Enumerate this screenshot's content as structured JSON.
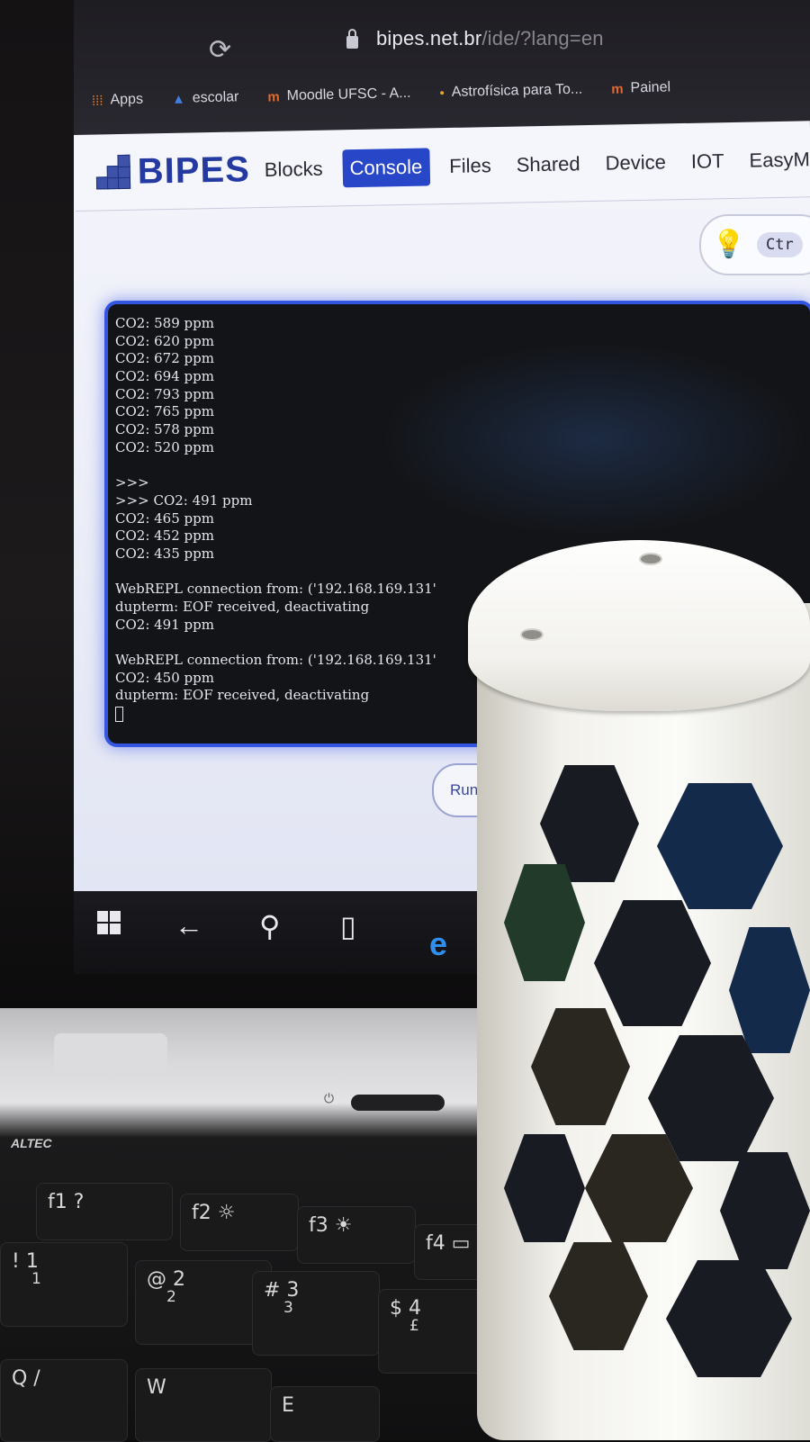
{
  "browser": {
    "url_host": "bipes.net.br",
    "url_path": "/ide/?lang=en",
    "bookmarks": [
      {
        "label": "Apps",
        "icon": "apps-grid-icon"
      },
      {
        "label": "escolar",
        "icon": "graduation-cap-icon"
      },
      {
        "label": "Moodle UFSC - A...",
        "icon": "moodle-icon"
      },
      {
        "label": "Astrofísica para To...",
        "icon": "bookmark-dot-icon"
      },
      {
        "label": "Painel",
        "icon": "moodle-icon"
      }
    ]
  },
  "app": {
    "logo": "BIPES",
    "nav": [
      {
        "label": "Blocks",
        "active": false
      },
      {
        "label": "Console",
        "active": true
      },
      {
        "label": "Files",
        "active": false
      },
      {
        "label": "Shared",
        "active": false
      },
      {
        "label": "Device",
        "active": false
      },
      {
        "label": "IOT",
        "active": false
      },
      {
        "label": "EasyMQ",
        "active": false
      }
    ],
    "tip_shortcut": "Ctr",
    "accent_color": "#2846c8"
  },
  "console": {
    "lines": [
      "CO2: 589 ppm",
      "CO2: 620 ppm",
      "CO2: 672 ppm",
      "CO2: 694 ppm",
      "CO2: 793 ppm",
      "CO2: 765 ppm",
      "CO2: 578 ppm",
      "CO2: 520 ppm",
      "",
      ">>>",
      ">>> CO2: 491 ppm",
      "CO2: 465 ppm",
      "CO2: 452 ppm",
      "CO2: 435 ppm",
      "",
      "WebREPL connection from: ('192.168.169.131'",
      "dupterm: EOF received, deactivating",
      "CO2: 491 ppm",
      "",
      "WebREPL connection from: ('192.168.169.131'",
      "CO2: 450 ppm",
      "dupterm: EOF received, deactivating"
    ]
  },
  "run_button": {
    "label": "Run bo"
  },
  "laptop": {
    "brand": "ALTEC",
    "keys": [
      {
        "primary": "f1 ?",
        "secondary": ""
      },
      {
        "primary": "f2 ☼",
        "secondary": ""
      },
      {
        "primary": "f3 ☀",
        "secondary": ""
      },
      {
        "primary": "f4 ▭",
        "secondary": ""
      },
      {
        "primary": "! 1",
        "secondary": "1"
      },
      {
        "primary": "@ 2",
        "secondary": "2"
      },
      {
        "primary": "# 3",
        "secondary": "3"
      },
      {
        "primary": "$ 4",
        "secondary": "£"
      },
      {
        "primary": "Q /",
        "secondary": ""
      },
      {
        "primary": "W",
        "secondary": ""
      },
      {
        "primary": "E",
        "secondary": ""
      }
    ]
  }
}
